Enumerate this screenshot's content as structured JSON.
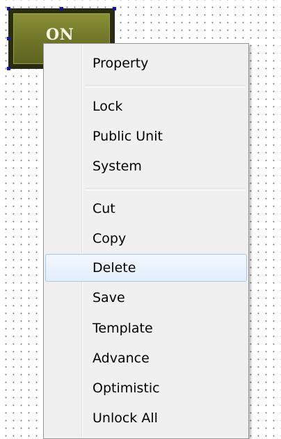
{
  "widget": {
    "label": "ON"
  },
  "context_menu": {
    "items": [
      {
        "label": "Property"
      },
      {
        "label": "Lock"
      },
      {
        "label": "Public Unit"
      },
      {
        "label": "System"
      },
      {
        "label": "Cut"
      },
      {
        "label": "Copy"
      },
      {
        "label": "Delete",
        "highlighted": true
      },
      {
        "label": "Save"
      },
      {
        "label": "Template"
      },
      {
        "label": "Advance"
      },
      {
        "label": "Optimistic"
      },
      {
        "label": "Unlock All"
      }
    ]
  },
  "colors": {
    "widget_face": "#7a7f2e",
    "menu_background": "#f0f0f0",
    "highlight_border": "#a9c8ea"
  }
}
